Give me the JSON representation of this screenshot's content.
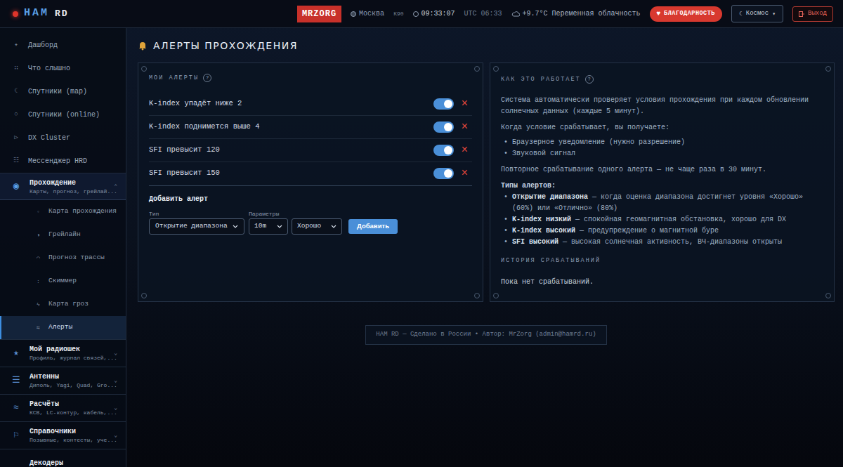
{
  "header": {
    "logo_a": "HAM",
    "logo_b": "RD",
    "callsign": "MRZORG",
    "city": "Москва",
    "locator": "K90",
    "time": "09:33:07",
    "utc": "UTC 06:33",
    "weather": "+9.7°C Переменная облачность",
    "thanks_icon": "♥",
    "thanks_button": "БЛАГОДАРНОСТЬ",
    "theme_icon": "☾",
    "theme_select": "Космос",
    "theme_arrow": "▾",
    "logout": "Выход"
  },
  "sidebar": {
    "items": [
      {
        "kind": "item",
        "icon": "✦",
        "label": "Дашборд"
      },
      {
        "kind": "item",
        "icon": "∷",
        "label": "Что слышно"
      },
      {
        "kind": "item",
        "icon": "☾",
        "label": "Спутники (map)"
      },
      {
        "kind": "item",
        "icon": "○",
        "label": "Спутники (online)"
      },
      {
        "kind": "item",
        "icon": "▷",
        "label": "DX Cluster"
      },
      {
        "kind": "item",
        "icon": "☷",
        "label": "Мессенджер HRD"
      },
      {
        "kind": "group",
        "icon": "◉",
        "label": "Прохождение",
        "subtitle": "Карты, прогноз, грейлай...",
        "chevron": "⌃",
        "expanded": true,
        "children": [
          {
            "icon": "◦",
            "label": "Карта прохождения",
            "selected": false
          },
          {
            "icon": "◑",
            "label": "Грейлайн",
            "selected": false
          },
          {
            "icon": "◠",
            "label": "Прогноз трассы",
            "selected": false
          },
          {
            "icon": ":",
            "label": "Скиммер",
            "selected": false
          },
          {
            "icon": "ϟ",
            "label": "Карта гроз",
            "selected": false
          },
          {
            "icon": "⇆",
            "label": "Алерты",
            "selected": true
          }
        ]
      },
      {
        "kind": "group",
        "icon": "★",
        "label": "Мой радиошек",
        "subtitle": "Профиль, журнал связей,...",
        "chevron": "⌄",
        "expanded": false,
        "children": []
      },
      {
        "kind": "group",
        "icon": "☰",
        "label": "Антенны",
        "subtitle": "Диполь, Yagi, Quad, Gro...",
        "chevron": "⌄",
        "expanded": false,
        "children": []
      },
      {
        "kind": "group",
        "icon": "≈",
        "label": "Расчёты",
        "subtitle": "КСВ, LC-контур, кабель,...",
        "chevron": "⌄",
        "expanded": false,
        "children": []
      },
      {
        "kind": "group",
        "icon": "⚐",
        "label": "Справочники",
        "subtitle": "Позывные, контесты, уче...",
        "chevron": "⌄",
        "expanded": false,
        "children": []
      },
      {
        "kind": "group",
        "icon": "",
        "label": "Декодеры",
        "subtitle": "",
        "chevron": "",
        "expanded": false,
        "children": []
      }
    ]
  },
  "page": {
    "title": "АЛЕРТЫ ПРОХОЖДЕНИЯ"
  },
  "my_alerts": {
    "title": "МОИ АЛЕРТЫ",
    "help": "?",
    "delete_icon": "×",
    "alerts": [
      {
        "label": "K-index упадёт ниже 2",
        "enabled": true
      },
      {
        "label": "K-index поднимется выше 4",
        "enabled": true
      },
      {
        "label": "SFI превысит 120",
        "enabled": true
      },
      {
        "label": "SFI превысит 150",
        "enabled": true
      }
    ],
    "form": {
      "title": "Добавить алерт",
      "type_label": "Тип",
      "params_label": "Параметры",
      "type_value": "Открытие диапазона",
      "band_value": "10m",
      "level_value": "Хорошо",
      "add_button": "Добавить"
    }
  },
  "how_it_works": {
    "title": "КАК ЭТО РАБОТАЕТ",
    "help": "?",
    "intro": "Система автоматически проверяет условия прохождения при каждом обновлении солнечных данных (каждые 5 минут).",
    "receive": "Когда условие срабатывает, вы получаете:",
    "bullets": [
      "Браузерное уведомление (нужно разрешение)",
      "Звуковой сигнал"
    ],
    "note": "Повторное срабатывание одного алерта — не чаще раза в 30 минут.",
    "types_title": "Типы алертов:",
    "types": [
      {
        "term": "Открытие диапазона",
        "text": " — когда оценка диапазона достигнет уровня «Хорошо» (60%) или «Отлично» (80%)"
      },
      {
        "term": "K-index низкий",
        "text": " — спокойная геомагнитная обстановка, хорошо для DX"
      },
      {
        "term": "K-index высокий",
        "text": " — предупреждение о магнитной буре"
      },
      {
        "term": "SFI высокий",
        "text": " — высокая солнечная активность, ВЧ-диапазоны открыты"
      }
    ],
    "history_title": "ИСТОРИЯ СРАБАТЫВАНИЙ",
    "history_empty": "Пока нет срабатываний."
  },
  "footer": {
    "text": "HAM RD — Сделано в России • Автор: MrZorg (admin@hamrd.ru)"
  }
}
